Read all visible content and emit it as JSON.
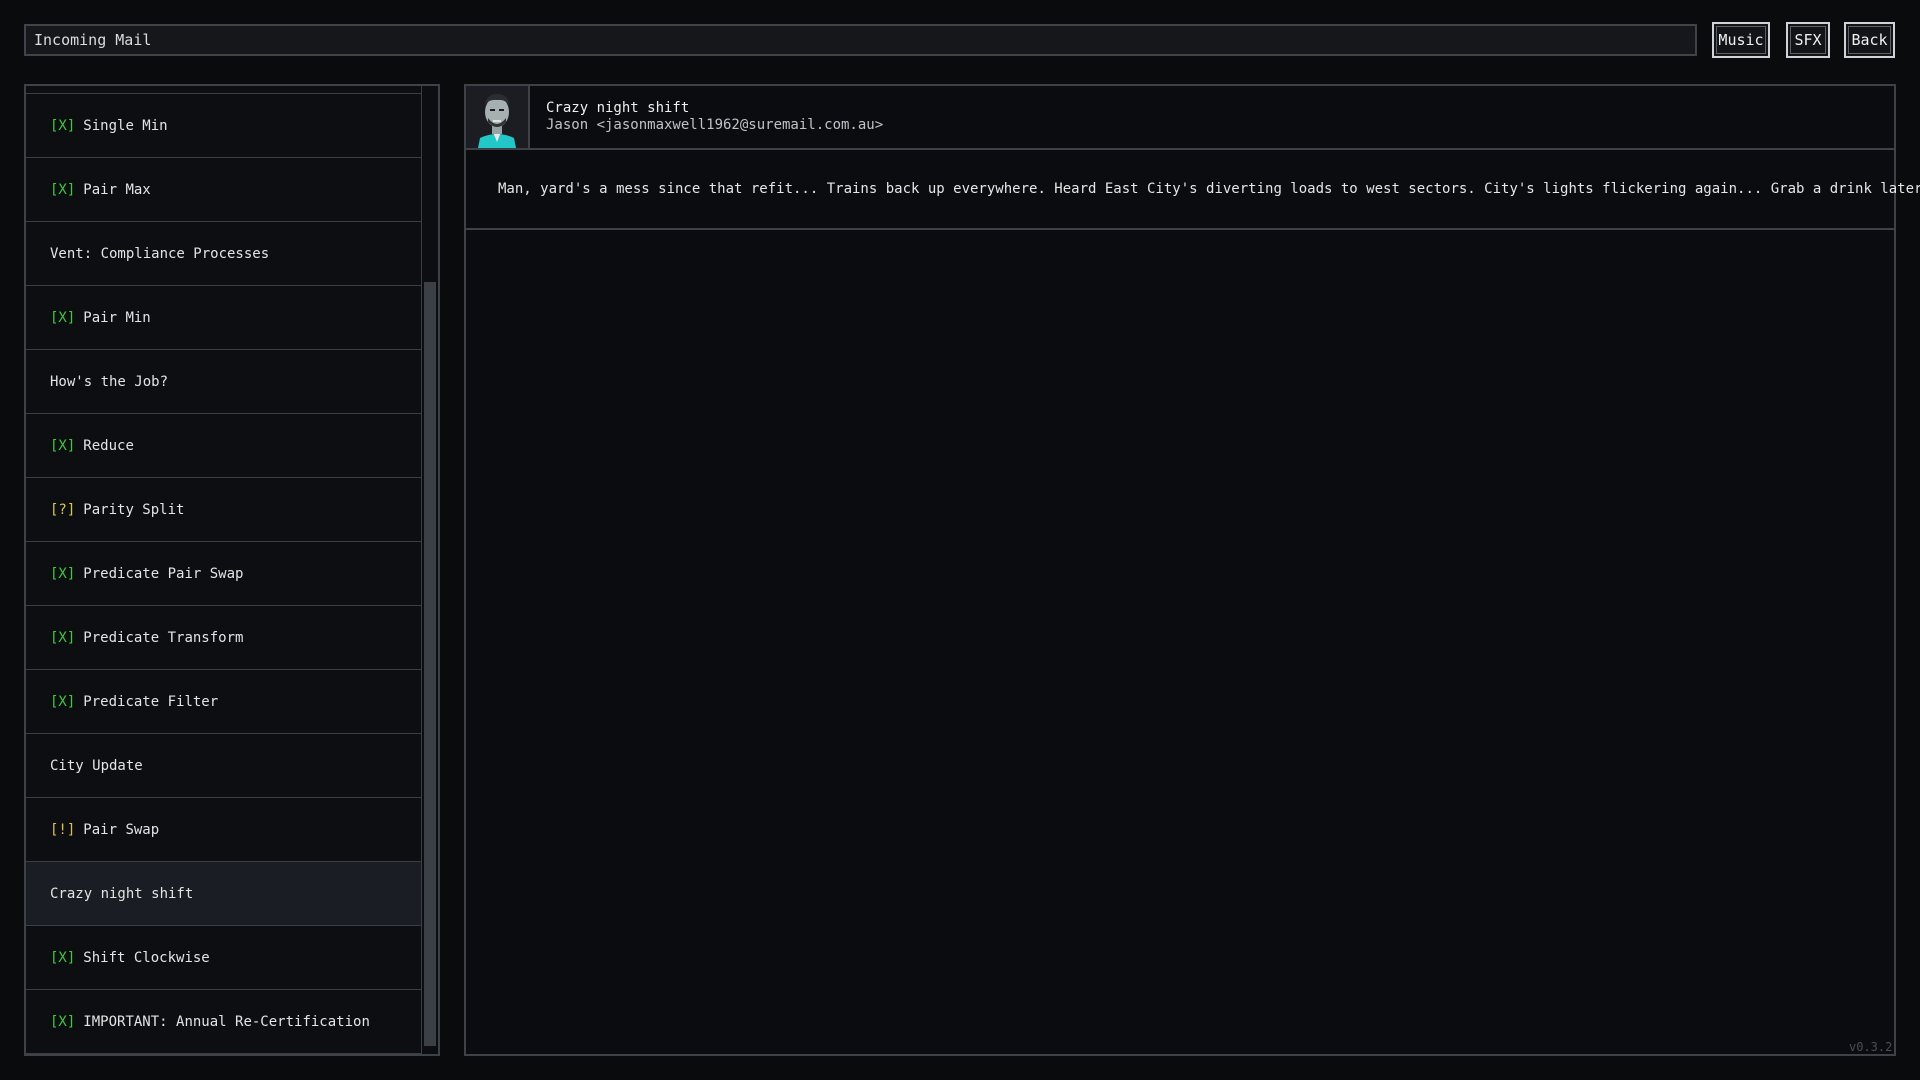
{
  "header": {
    "title": "Incoming Mail",
    "buttons": {
      "music": "Music",
      "sfx": "SFX",
      "back": "Back"
    }
  },
  "mail_list": {
    "items": [
      {
        "status": "[X]",
        "label": "Single Min",
        "status_color": "#3ec93e"
      },
      {
        "status": "[X]",
        "label": "Pair Max",
        "status_color": "#3ec93e"
      },
      {
        "status": "",
        "label": "Vent: Compliance Processes"
      },
      {
        "status": "[X]",
        "label": "Pair Min",
        "status_color": "#3ec93e"
      },
      {
        "status": "",
        "label": "How's the Job?"
      },
      {
        "status": "[X]",
        "label": "Reduce",
        "status_color": "#3ec93e"
      },
      {
        "status": "[?]",
        "label": "Parity Split",
        "status_color": "#d8c94a"
      },
      {
        "status": "[X]",
        "label": "Predicate Pair Swap",
        "status_color": "#3ec93e"
      },
      {
        "status": "[X]",
        "label": "Predicate Transform",
        "status_color": "#3ec93e"
      },
      {
        "status": "[X]",
        "label": "Predicate Filter",
        "status_color": "#3ec93e"
      },
      {
        "status": "",
        "label": "City Update"
      },
      {
        "status": "[!]",
        "label": "Pair Swap",
        "status_color": "#e0c04a"
      },
      {
        "status": "",
        "label": "Crazy night shift",
        "selected": true
      },
      {
        "status": "[X]",
        "label": "Shift Clockwise",
        "status_color": "#3ec93e"
      },
      {
        "status": "[X]",
        "label": "IMPORTANT: Annual Re-Certification",
        "status_color": "#3ec93e"
      }
    ]
  },
  "message": {
    "subject": "Crazy night shift",
    "sender": "Jason <jasonmaxwell1962@suremail.com.au>",
    "body": "Man, yard's a mess since that refit... Trains back up everywhere. Heard East City's diverting loads to west sectors. City's lights flickering again... Grab a drink later?",
    "avatar_icon": "sender-portrait"
  },
  "footer": {
    "version": "v0.3.2"
  },
  "colors": {
    "background": "#0a0b0d",
    "panel_border": "#3d4249",
    "status_done": "#3ec93e",
    "status_unknown": "#d8c94a",
    "status_alert": "#e0c04a",
    "avatar_accent": "#22c7c7"
  }
}
